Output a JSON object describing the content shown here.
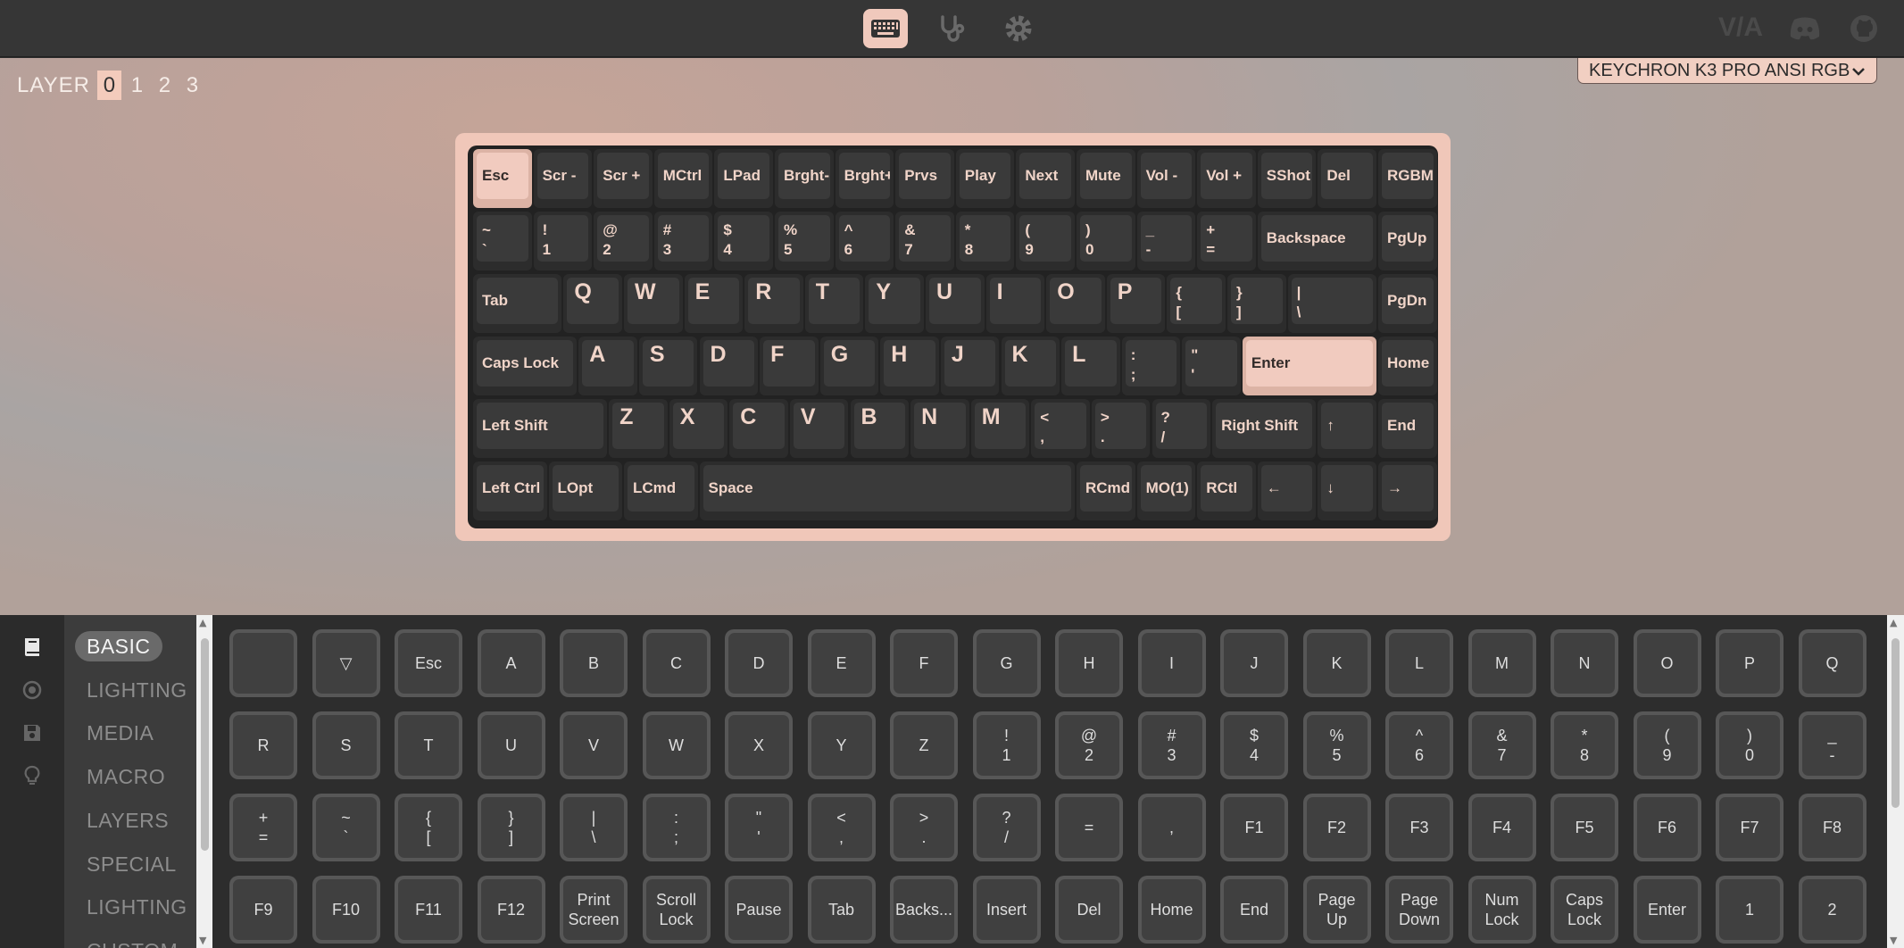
{
  "colors": {
    "accent": "#f0c9bc",
    "keycap_dark": "#3a3a3a",
    "legend": "#f0d4c8",
    "topbar": "#363636"
  },
  "top_nav": {
    "icons": [
      "keyboard-icon",
      "stethoscope-icon",
      "gear-icon"
    ],
    "brand_icons": [
      "via-logo",
      "discord-icon",
      "github-icon"
    ]
  },
  "layers": {
    "label": "LAYER",
    "numbers": [
      "0",
      "1",
      "2",
      "3"
    ],
    "active": "0"
  },
  "device": {
    "name": "KEYCHRON K3 PRO ANSI RGB"
  },
  "keyboard": {
    "rows": [
      [
        [
          "Esc"
        ],
        [
          "Scr -"
        ],
        [
          "Scr +"
        ],
        [
          "MCtrl"
        ],
        [
          "LPad"
        ],
        [
          "Brght-"
        ],
        [
          "Brght+"
        ],
        [
          "Prvs"
        ],
        [
          "Play"
        ],
        [
          "Next"
        ],
        [
          "Mute"
        ],
        [
          "Vol -"
        ],
        [
          "Vol +"
        ],
        [
          "SShot"
        ],
        [
          "Del"
        ],
        [
          "RGBMo"
        ]
      ],
      [
        [
          "~",
          "`"
        ],
        [
          "!",
          "1"
        ],
        [
          "@",
          "2"
        ],
        [
          "#",
          "3"
        ],
        [
          "$",
          "4"
        ],
        [
          "%",
          "5"
        ],
        [
          "^",
          "6"
        ],
        [
          "&",
          "7"
        ],
        [
          "*",
          "8"
        ],
        [
          "(",
          "9"
        ],
        [
          ")",
          "0"
        ],
        [
          "_",
          "-"
        ],
        [
          "+",
          "="
        ],
        [
          "Backspace"
        ],
        [
          "PgUp"
        ]
      ],
      [
        [
          "Tab"
        ],
        [
          "Q"
        ],
        [
          "W"
        ],
        [
          "E"
        ],
        [
          "R"
        ],
        [
          "T"
        ],
        [
          "Y"
        ],
        [
          "U"
        ],
        [
          "I"
        ],
        [
          "O"
        ],
        [
          "P"
        ],
        [
          "{",
          "["
        ],
        [
          "}",
          "]"
        ],
        [
          "|",
          "\\"
        ],
        [
          "PgDn"
        ]
      ],
      [
        [
          "Caps Lock"
        ],
        [
          "A"
        ],
        [
          "S"
        ],
        [
          "D"
        ],
        [
          "F"
        ],
        [
          "G"
        ],
        [
          "H"
        ],
        [
          "J"
        ],
        [
          "K"
        ],
        [
          "L"
        ],
        [
          ":",
          ";"
        ],
        [
          "\"",
          "'"
        ],
        [
          "Enter"
        ],
        [
          "Home"
        ]
      ],
      [
        [
          "Left Shift"
        ],
        [
          "Z"
        ],
        [
          "X"
        ],
        [
          "C"
        ],
        [
          "V"
        ],
        [
          "B"
        ],
        [
          "N"
        ],
        [
          "M"
        ],
        [
          "<",
          ","
        ],
        [
          ">",
          "."
        ],
        [
          "?",
          "/"
        ],
        [
          "Right Shift"
        ],
        [
          "↑"
        ],
        [
          "End"
        ]
      ],
      [
        [
          "Left Ctrl"
        ],
        [
          "LOpt"
        ],
        [
          "LCmd"
        ],
        [
          "Space"
        ],
        [
          "RCmd"
        ],
        [
          "MO(1)"
        ],
        [
          "RCtl"
        ],
        [
          "←"
        ],
        [
          "↓"
        ],
        [
          "→"
        ]
      ]
    ]
  },
  "sidebar": {
    "icons": [
      "book-icon",
      "record-icon",
      "save-icon",
      "bulb-icon"
    ],
    "menu": [
      "BASIC",
      "LIGHTING",
      "MEDIA",
      "MACRO",
      "LAYERS",
      "SPECIAL",
      "LIGHTING",
      "CUSTOM"
    ],
    "active": "BASIC"
  },
  "key_grid": [
    "",
    "▽",
    "Esc",
    "A",
    "B",
    "C",
    "D",
    "E",
    "F",
    "G",
    "H",
    "I",
    "J",
    "K",
    "L",
    "M",
    "N",
    "O",
    "P",
    "Q",
    "R",
    "S",
    "T",
    "U",
    "V",
    "W",
    "X",
    "Y",
    "Z",
    "!\n1",
    "@\n2",
    "#\n3",
    "$\n4",
    "%\n5",
    "^\n6",
    "&\n7",
    "*\n8",
    "(\n9",
    ")\n0",
    "_\n-",
    "+\n=",
    "~\n`",
    "{\n[",
    "}\n]",
    "|\n\\",
    ":\n;",
    "\"\n'",
    "<\n,",
    ">\n.",
    "?\n/",
    "=",
    ",",
    "F1",
    "F2",
    "F3",
    "F4",
    "F5",
    "F6",
    "F7",
    "F8",
    "F9",
    "F10",
    "F11",
    "F12",
    "Print\nScreen",
    "Scroll\nLock",
    "Pause",
    "Tab",
    "Backs...",
    "Insert",
    "Del",
    "Home",
    "End",
    "Page\nUp",
    "Page\nDown",
    "Num\nLock",
    "Caps\nLock",
    "Enter",
    "1",
    "2"
  ]
}
